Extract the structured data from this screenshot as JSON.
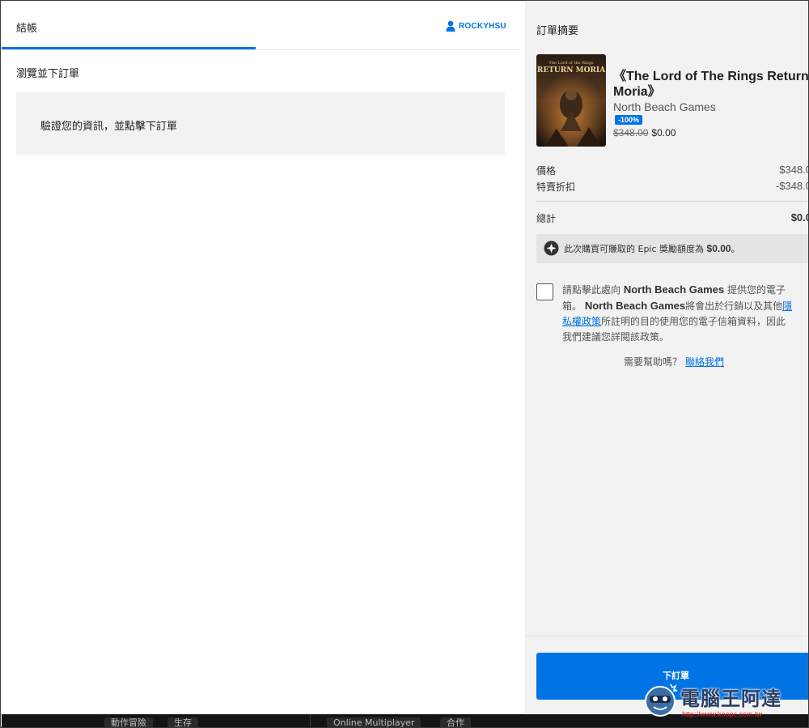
{
  "checkout": {
    "tab_title": "結帳",
    "user_name": "ROCKYHSU",
    "section_title": "瀏覽並下訂單",
    "info_message": "驗證您的資訊，並點擊下訂單"
  },
  "summary": {
    "title": "訂單摘要",
    "product": {
      "title_line1": "《The Lord of The Rings Return",
      "title_line2": "Moria》",
      "publisher": "North Beach Games",
      "discount_badge": "-100%",
      "original_price": "$348.00",
      "current_price": "$0.00",
      "cover_text": "RETURN MORIA"
    },
    "price_label": "價格",
    "price_value": "$348.0",
    "discount_label": "特賣折扣",
    "discount_value": "-$348.0",
    "total_label": "總計",
    "total_value": "$0.0",
    "reward_prefix": "此次購買可賺取的 Epic 獎勵額度為",
    "reward_amount": "$0.00",
    "reward_suffix": "。",
    "consent": {
      "l1_pre": "請點擊此處向",
      "l1_bold": "North Beach Games",
      "l1_post": "提供您的電子",
      "l2_pre": "箱。",
      "l2_bold": "North Beach Games",
      "l2_post": "將會出於行銷以及其他",
      "l2_link": "隱",
      "l3_link": "私權政策",
      "l3_post": "所註明的目的使用您的電子信箱資料，因此",
      "l4": "我們建議您詳閱該政策。"
    },
    "help_text": "需要幫助嗎？",
    "help_link": "聯絡我們",
    "place_order": "下訂單"
  },
  "bottom_strip": {
    "chips": [
      "動作冒險",
      "生存",
      "Online Multiplayer",
      "合作"
    ]
  },
  "watermark": {
    "text": "電腦王阿達",
    "url": "http://www.koopc.com.tw"
  },
  "colors": {
    "accent": "#0074e4",
    "panel_bg": "#f2f2f2"
  }
}
